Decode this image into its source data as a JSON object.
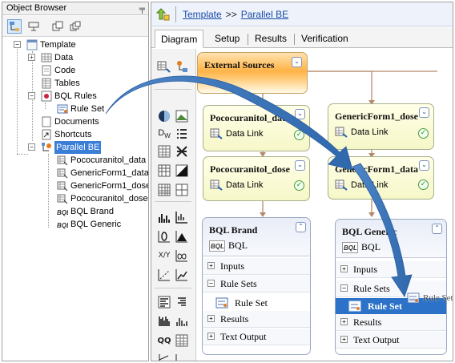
{
  "object_browser": {
    "title": "Object Browser",
    "pin_glyph": "╤",
    "tree": {
      "root": "Template",
      "children": [
        "Data",
        "Code",
        "Tables",
        "BQL Rules",
        "Documents",
        "Shortcuts"
      ],
      "bql_rules_child": "Rule Set",
      "parallel_be": "Parallel BE",
      "parallel_children": [
        "Pococuranitol_data",
        "GenericForm1_data",
        "GenericForm1_dose",
        "Pococuranitol_dose",
        "BQL Brand",
        "BQL Generic"
      ]
    }
  },
  "breadcrumb": {
    "items": [
      "Template",
      "Parallel BE"
    ],
    "separator": ">>"
  },
  "tabs": [
    "Diagram",
    "Setup",
    "Results",
    "Verification"
  ],
  "diagram": {
    "external_sources": "External Sources",
    "data_nodes": [
      {
        "title": "Pococuranitol_data",
        "link": "Data Link"
      },
      {
        "title": "GenericForm1_dose",
        "link": "Data Link"
      },
      {
        "title": "Pococuranitol_dose",
        "link": "Data Link"
      },
      {
        "title": "GenericForm1_data",
        "link": "Data Link"
      }
    ],
    "bql_nodes": [
      {
        "title": "BQL Brand",
        "sub": "BQL",
        "sections": [
          "Inputs",
          "Rule Sets",
          "Results",
          "Text Output"
        ],
        "rule_item": "Rule Set"
      },
      {
        "title": "BQL Generic",
        "sub": "BQL",
        "sections": [
          "Inputs",
          "Rule Sets",
          "Results",
          "Text Output"
        ],
        "rule_item": "Rule Set",
        "drag_ghost": "Rule Set"
      }
    ],
    "expand_glyph": "⌄",
    "check_glyph": "✓"
  },
  "palette_icons": [
    "table-flow-icon",
    "circle-icon",
    "image-icon",
    "dw-icon",
    "list-icon",
    "table-icon",
    "x-icon",
    "grid-icon",
    "contrast-icon",
    "matrix-icon",
    "grid2-icon",
    "bar-chart-icon",
    "line-chart-icon",
    "loop-icon",
    "mountain-chart-icon",
    "xy-icon",
    "infinity-icon",
    "slope-icon",
    "trend-icon",
    "align-left-icon",
    "align-right-icon",
    "barcode-icon",
    "hist-icon",
    "qq-icon",
    "table2-icon",
    "axis-icon",
    "chart2-icon"
  ],
  "colors": {
    "link": "#1a4aa8",
    "selection": "#2b72c8",
    "arrow": "#3a78c0",
    "external_sources_fill": "#ffb347",
    "data_node_fill": "#f6f7c8"
  }
}
